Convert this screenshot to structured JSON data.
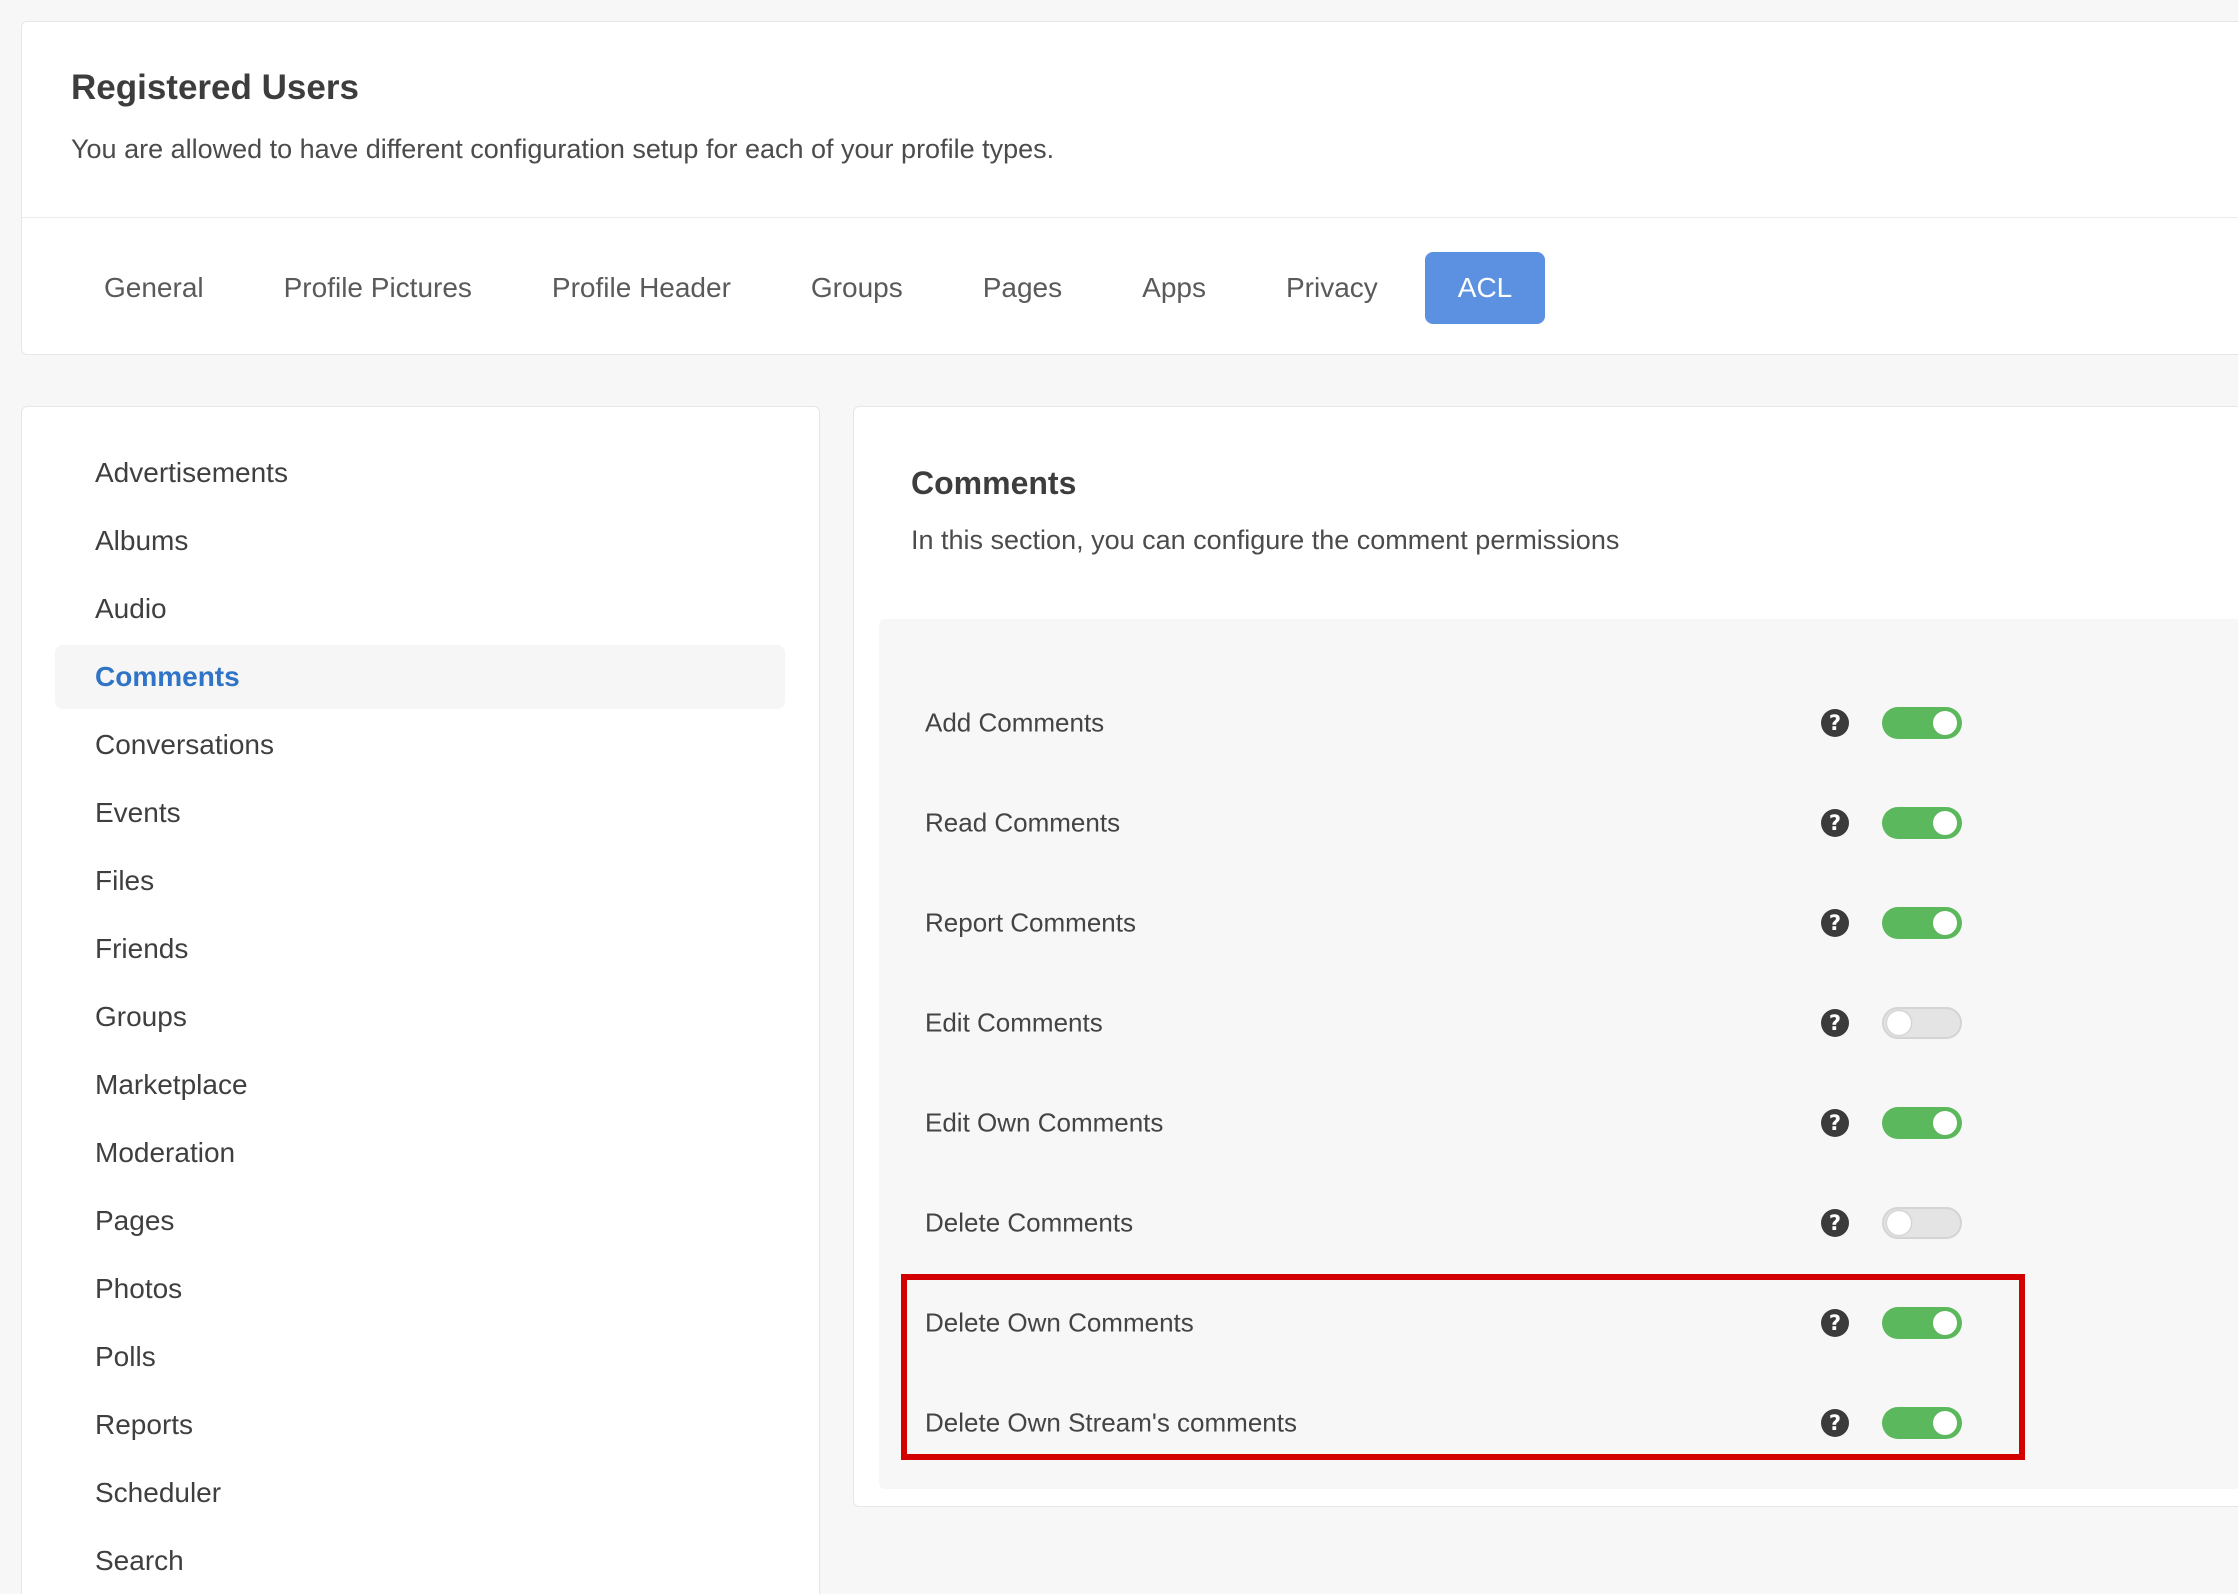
{
  "header": {
    "title": "Registered Users",
    "subtitle": "You are allowed to have different configuration setup for each of your profile types."
  },
  "tabs": [
    {
      "label": "General"
    },
    {
      "label": "Profile Pictures"
    },
    {
      "label": "Profile Header"
    },
    {
      "label": "Groups"
    },
    {
      "label": "Pages"
    },
    {
      "label": "Apps"
    },
    {
      "label": "Privacy"
    },
    {
      "label": "ACL",
      "active": true
    }
  ],
  "sidebar": {
    "items": [
      {
        "label": "Advertisements"
      },
      {
        "label": "Albums"
      },
      {
        "label": "Audio"
      },
      {
        "label": "Comments",
        "active": true
      },
      {
        "label": "Conversations"
      },
      {
        "label": "Events"
      },
      {
        "label": "Files"
      },
      {
        "label": "Friends"
      },
      {
        "label": "Groups"
      },
      {
        "label": "Marketplace"
      },
      {
        "label": "Moderation"
      },
      {
        "label": "Pages"
      },
      {
        "label": "Photos"
      },
      {
        "label": "Polls"
      },
      {
        "label": "Reports"
      },
      {
        "label": "Scheduler"
      },
      {
        "label": "Search"
      }
    ]
  },
  "section": {
    "title": "Comments",
    "description": "In this section, you can configure the comment permissions",
    "help_glyph": "?",
    "settings": [
      {
        "label": "Add Comments",
        "enabled": true
      },
      {
        "label": "Read Comments",
        "enabled": true
      },
      {
        "label": "Report Comments",
        "enabled": true
      },
      {
        "label": "Edit Comments",
        "enabled": false
      },
      {
        "label": "Edit Own Comments",
        "enabled": true
      },
      {
        "label": "Delete Comments",
        "enabled": false
      },
      {
        "label": "Delete Own Comments",
        "enabled": true
      },
      {
        "label": "Delete Own Stream's comments",
        "enabled": true
      }
    ]
  },
  "colors": {
    "accent": "#5b91e0",
    "active_link": "#2f74c6",
    "toggle_on": "#5cb85c",
    "highlight": "#d30000"
  }
}
